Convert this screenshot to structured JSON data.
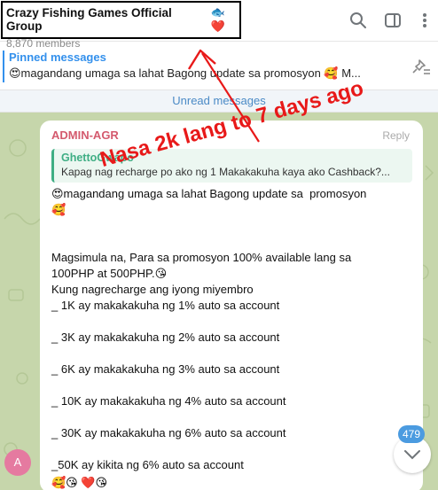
{
  "header": {
    "title": "Crazy Fishing Games Official Group",
    "title_emojis": "🐟❤️",
    "subtitle": "8,870 members"
  },
  "pinned": {
    "label": "Pinned messages",
    "text": "😍magandang umaga sa lahat Bagong update sa  promosyon   🥰  M..."
  },
  "unread_label": "Unread messages",
  "message": {
    "sender": "ADMIN-AGR",
    "reply_label": "Reply",
    "quote": {
      "name": "GhettoGwapo",
      "text": "Kapag nag recharge po ako ng 1 Makakakuha kaya ako Cashback?..."
    },
    "body": "😍magandang umaga sa lahat Bagong update sa  promosyon\n🥰\n\n\nMagsimula na, Para sa promosyon 100% available lang sa\n100PHP at 500PHP.😘\nKung nagrecharge ang iyong miyembro\n_ 1K ay makakakuha ng 1% auto sa account\n\n_ 3K ay makakakuha ng 2% auto sa account\n\n_ 6K ay makakakuha ng 3% auto sa account\n\n_ 10K ay makakakuha ng 4% auto sa account\n\n_ 30K ay makakakuha ng 6% auto sa account\n\n_50K ay kikita ng 6% auto sa account",
    "reactions": "🥰😘 ❤️😘"
  },
  "annotation": {
    "text": "Nasa 2k lang to 7 days ago",
    "color": "#e81919"
  },
  "avatar_letter": "A",
  "unread_count": "479",
  "colors": {
    "accent": "#3390ec",
    "sender": "#d45a6e",
    "quote": "#3fae84",
    "chat_bg": "#c6d6ab"
  }
}
